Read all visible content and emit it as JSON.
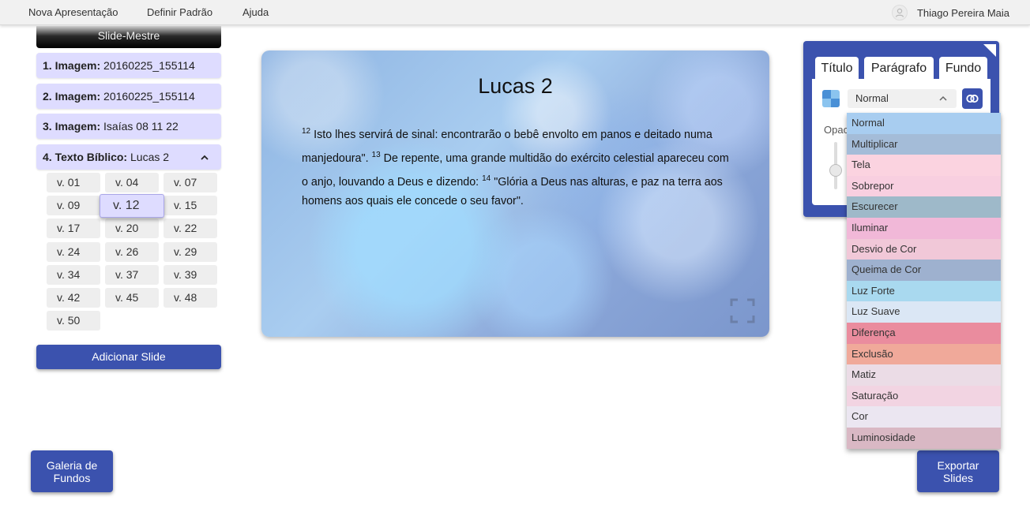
{
  "menu": {
    "items": [
      "Nova Apresentação",
      "Definir Padrão",
      "Ajuda"
    ],
    "user_name": "Thiago Pereira Maia"
  },
  "sidebar": {
    "master_label": "Slide-Mestre",
    "slides": [
      {
        "number": "1.",
        "type": "Imagem:",
        "name": "20160225_155114"
      },
      {
        "number": "2.",
        "type": "Imagem:",
        "name": "20160225_155114"
      },
      {
        "number": "3.",
        "type": "Imagem:",
        "name": "Isaías 08 11 22"
      },
      {
        "number": "4.",
        "type": "Texto Bíblico:",
        "name": "Lucas 2"
      }
    ],
    "verses": [
      "v. 01",
      "v. 04",
      "v. 07",
      "v. 09",
      "v. 12",
      "v. 15",
      "v. 17",
      "v. 20",
      "v. 22",
      "v. 24",
      "v. 26",
      "v. 29",
      "v. 34",
      "v. 37",
      "v. 39",
      "v. 42",
      "v. 45",
      "v. 48",
      "v. 50"
    ],
    "active_verse": "v. 12",
    "add_slide_label": "Adicionar Slide"
  },
  "slide": {
    "title": "Lucas 2",
    "verses": [
      {
        "num": "12",
        "text": " Isto lhes servirá de sinal: encontrarão o bebê envolto em panos e deitado numa manjedoura\". "
      },
      {
        "num": "13",
        "text": " De repente, uma grande multidão do exército celestial apareceu com o anjo, louvando a Deus e dizendo: "
      },
      {
        "num": "14",
        "text": " \"Glória a Deus nas alturas, e paz na terra aos homens aos quais ele concede o seu favor\"."
      }
    ]
  },
  "panel": {
    "tabs": [
      "Título",
      "Parágrafo",
      "Fundo"
    ],
    "active_tab": "Fundo",
    "blend_value": "Normal",
    "opacity_label": "Opac",
    "blend_options": [
      {
        "label": "Normal",
        "color": "#a8cdf0"
      },
      {
        "label": "Multiplicar",
        "color": "#a4bcd8"
      },
      {
        "label": "Tela",
        "color": "#fbd3e0"
      },
      {
        "label": "Sobrepor",
        "color": "#f8cfe0"
      },
      {
        "label": "Escurecer",
        "color": "#9eb9c9"
      },
      {
        "label": "Iluminar",
        "color": "#f1b8d8"
      },
      {
        "label": "Desvio de Cor",
        "color": "#f1c8d8"
      },
      {
        "label": "Queima de Cor",
        "color": "#9eb1cf"
      },
      {
        "label": "Luz Forte",
        "color": "#a9d9ef"
      },
      {
        "label": "Luz Suave",
        "color": "#dbe7f5"
      },
      {
        "label": "Diferença",
        "color": "#ea8c9e"
      },
      {
        "label": "Exclusão",
        "color": "#f0a99a"
      },
      {
        "label": "Matiz",
        "color": "#ebdce6"
      },
      {
        "label": "Saturação",
        "color": "#f2d4e2"
      },
      {
        "label": "Cor",
        "color": "#ebe6f1"
      },
      {
        "label": "Luminosidade",
        "color": "#d9b8c4"
      }
    ]
  },
  "buttons": {
    "gallery_line1": "Galeria de",
    "gallery_line2": "Fundos",
    "export_line1": "Exportar",
    "export_line2": "Slides"
  },
  "colors": {
    "primary": "#3b52ae",
    "slide_item_bg": "#dedcff"
  }
}
